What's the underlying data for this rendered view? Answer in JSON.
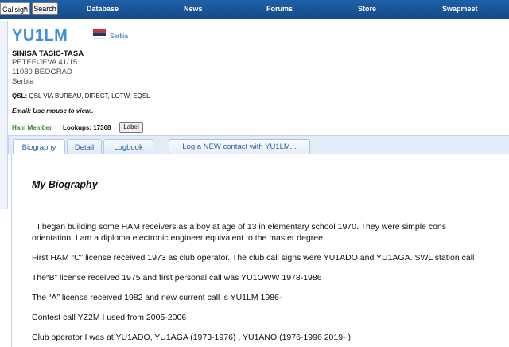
{
  "topbar": {
    "search_select_value": "Callsign",
    "search_button_label": "Search",
    "nav": [
      "Database",
      "News",
      "Forums",
      "Store",
      "Swapmeet"
    ]
  },
  "profile": {
    "callsign": "YU1LM",
    "country": "Serbia",
    "name": "SINISA TASIC-TASA",
    "address": [
      "PETEFIJEVA 41/15",
      "11030 BEOGRAD",
      "Serbia"
    ],
    "qsl_label": "QSL:",
    "qsl_value": "QSL VIA BUREAU, DIRECT, LOTW, EQSL",
    "email_text": "Email: Use mouse to view..",
    "member_status": "Ham Member",
    "lookups_text": "Lookups: 17368",
    "label_button": "Label"
  },
  "tabs": {
    "items": [
      "Biography",
      "Detail",
      "Logbook"
    ],
    "active": "Biography",
    "log_button": "Log a NEW contact with YU1LM..."
  },
  "bio": {
    "heading": "My Biography",
    "lines": [
      "I began building some HAM receivers as a boy at age of 13 in elementary school 1970. They were simple cons",
      "orientation. I am a diploma electronic engineer equivalent to the master degree.",
      "First HAM “C” license received 1973 as club operator. The club call signs were YU1ADO and YU1AGA. SWL station call",
      "The“B” license received 1975 and first personal call was YU1OWW 1978-1986",
      "The “A” license received 1982 and new current call is YU1LM 1986-",
      "Contest call YZ2M I used from 2005-2006",
      "Club operator I was at YU1ADO, YU1AGA (1973-1976) , YU1ANO (1976-1996   2019-   )"
    ]
  },
  "colors": {
    "topbar": "#1f5fa9",
    "callsign": "#3d8fe0",
    "member": "#2a8a2a",
    "link": "#2b6cc0"
  }
}
